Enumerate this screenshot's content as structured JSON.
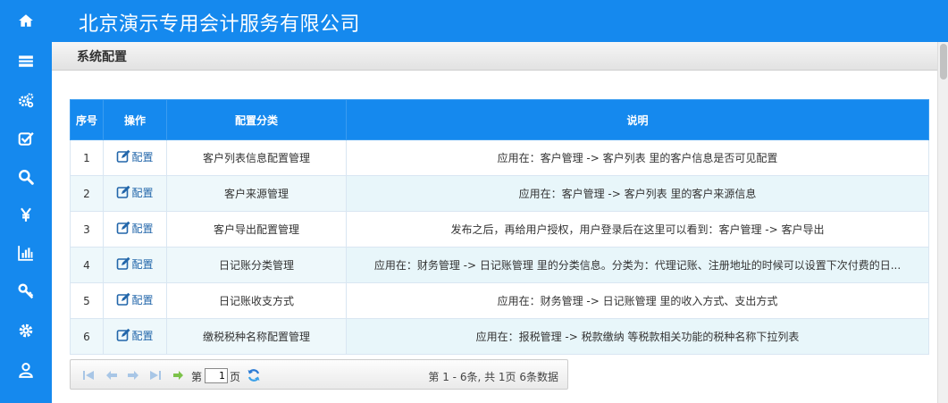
{
  "header": {
    "company": "北京演示专用会计服务有限公司"
  },
  "titlebar": {
    "title": "系统配置"
  },
  "sidebar": {
    "items": [
      {
        "icon": "home-icon"
      },
      {
        "icon": "list-icon"
      },
      {
        "icon": "cogs-icon"
      },
      {
        "icon": "check-square-icon"
      },
      {
        "icon": "search-icon"
      },
      {
        "icon": "yen-icon"
      },
      {
        "icon": "bar-chart-icon"
      },
      {
        "icon": "key-icon"
      },
      {
        "icon": "gear-icon"
      },
      {
        "icon": "user-icon"
      }
    ]
  },
  "table": {
    "headers": [
      "序号",
      "操作",
      "配置分类",
      "说明"
    ],
    "action_label": "配置",
    "rows": [
      {
        "no": "1",
        "category": "客户列表信息配置管理",
        "desc": "应用在：客户管理 -> 客户列表 里的客户信息是否可见配置"
      },
      {
        "no": "2",
        "category": "客户来源管理",
        "desc": "应用在：客户管理 -> 客户列表 里的客户来源信息"
      },
      {
        "no": "3",
        "category": "客户导出配置管理",
        "desc": "发布之后，再给用户授权，用户登录后在这里可以看到：客户管理 -> 客户导出"
      },
      {
        "no": "4",
        "category": "日记账分类管理",
        "desc": "应用在：财务管理 -> 日记账管理 里的分类信息。分类为：代理记账、注册地址的时候可以设置下次付费的日..."
      },
      {
        "no": "5",
        "category": "日记账收支方式",
        "desc": "应用在：财务管理 -> 日记账管理 里的收入方式、支出方式"
      },
      {
        "no": "6",
        "category": "缴税税种名称配置管理",
        "desc": "应用在：报税管理 -> 税款缴纳 等税款相关功能的税种名称下拉列表"
      }
    ]
  },
  "pager": {
    "page_prefix": "第",
    "page_value": "1",
    "page_suffix": "页",
    "info": "第 1 - 6条, 共 1页 6条数据"
  },
  "colors": {
    "brand": "#1589ee",
    "row_alt": "#eef8fb",
    "link": "#2266aa"
  }
}
